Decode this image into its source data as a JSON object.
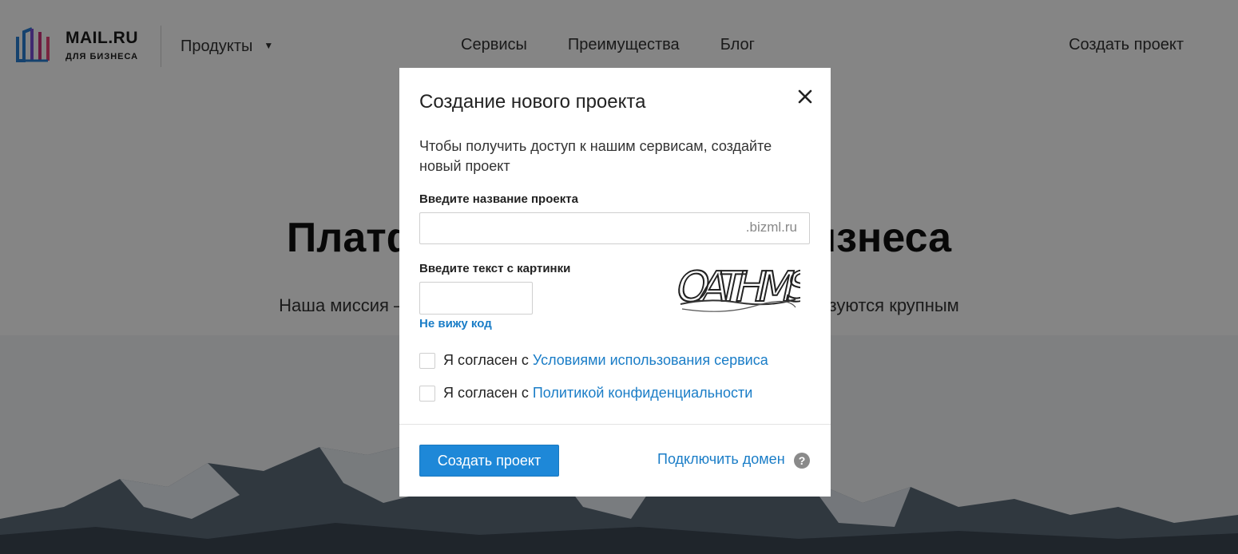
{
  "header": {
    "logo_title": "MAIL.RU",
    "logo_subtitle": "ДЛЯ БИЗНЕСА",
    "products_label": "Продукты",
    "products_caret": "▼",
    "nav": [
      "Сервисы",
      "Преимущества",
      "Блог"
    ],
    "create_project": "Создать проект"
  },
  "hero": {
    "title": "Платформа для вашего бизнеса",
    "subtitle": "Наша миссия — предоставить компаниям сервисы, которыми пользуются крупным"
  },
  "modal": {
    "title": "Создание нового проекта",
    "close_symbol": "✕",
    "description": "Чтобы получить доступ к нашим сервисам, создайте новый проект",
    "project_name_label": "Введите название проекта",
    "project_name_value": "",
    "project_domain_suffix": ".bizml.ru",
    "captcha_label": "Введите текст с картинки",
    "captcha_value": "",
    "captcha_image_text": "OATHMS",
    "no_code_link": "Не вижу код",
    "terms_prefix": "Я согласен с",
    "terms_link": "Условиями использования сервиса",
    "terms_checked": false,
    "privacy_prefix": "Я согласен с",
    "privacy_link": "Политикой конфиденциальности",
    "privacy_checked": false,
    "submit_label": "Создать проект",
    "connect_domain_link": "Подключить домен",
    "help_symbol": "?"
  },
  "colors": {
    "accent": "#1e88d8",
    "link": "#1a7dc7",
    "overlay": "rgba(0,0,0,0.48)"
  }
}
